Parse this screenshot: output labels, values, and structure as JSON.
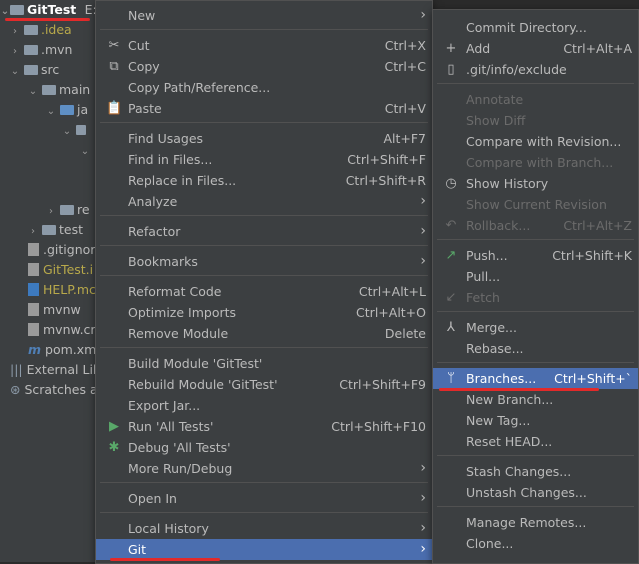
{
  "tree": {
    "title": "GitTest",
    "title_path": "E:\\",
    "rows": [
      {
        "label": ".idea",
        "kind": "folder"
      },
      {
        "label": ".mvn",
        "kind": "folder"
      },
      {
        "label": "src",
        "kind": "folder"
      },
      {
        "label": "main",
        "kind": "folder"
      },
      {
        "label": "ja",
        "kind": "folder-blue"
      },
      {
        "label": "re",
        "kind": "folder"
      },
      {
        "label": "test",
        "kind": "folder"
      },
      {
        "label": ".gitignor",
        "kind": "file"
      },
      {
        "label": "GitTest.i",
        "kind": "file"
      },
      {
        "label": "HELP.mc",
        "kind": "file"
      },
      {
        "label": "mvnw",
        "kind": "file"
      },
      {
        "label": "mvnw.cr",
        "kind": "file"
      },
      {
        "label": "pom.xm",
        "kind": "file"
      },
      {
        "label": "External Lib",
        "kind": "lib"
      },
      {
        "label": "Scratches a",
        "kind": "scratch"
      }
    ]
  },
  "menu1": {
    "new": "New",
    "cut": "Cut",
    "cut_sc": "Ctrl+X",
    "copy": "Copy",
    "copy_sc": "Ctrl+C",
    "copy_path": "Copy Path/Reference...",
    "paste": "Paste",
    "paste_sc": "Ctrl+V",
    "find_usages": "Find Usages",
    "find_usages_sc": "Alt+F7",
    "find_in_files": "Find in Files...",
    "find_in_files_sc": "Ctrl+Shift+F",
    "replace_in_files": "Replace in Files...",
    "replace_in_files_sc": "Ctrl+Shift+R",
    "analyze": "Analyze",
    "refactor": "Refactor",
    "bookmarks": "Bookmarks",
    "reformat": "Reformat Code",
    "reformat_sc": "Ctrl+Alt+L",
    "optimize": "Optimize Imports",
    "optimize_sc": "Ctrl+Alt+O",
    "remove_module": "Remove Module",
    "remove_module_sc": "Delete",
    "build_module": "Build Module 'GitTest'",
    "rebuild_module": "Rebuild Module 'GitTest'",
    "rebuild_module_sc": "Ctrl+Shift+F9",
    "export_jar": "Export Jar...",
    "run_tests": "Run 'All Tests'",
    "run_tests_sc": "Ctrl+Shift+F10",
    "debug_tests": "Debug 'All Tests'",
    "more_run": "More Run/Debug",
    "open_in": "Open In",
    "local_history": "Local History",
    "git": "Git"
  },
  "menu2": {
    "commit_dir": "Commit Directory...",
    "add": "Add",
    "add_sc": "Ctrl+Alt+A",
    "exclude": ".git/info/exclude",
    "annotate": "Annotate",
    "show_diff": "Show Diff",
    "compare_revision": "Compare with Revision...",
    "compare_branch": "Compare with Branch...",
    "show_history": "Show History",
    "show_current": "Show Current Revision",
    "rollback": "Rollback...",
    "rollback_sc": "Ctrl+Alt+Z",
    "push": "Push...",
    "push_sc": "Ctrl+Shift+K",
    "pull": "Pull...",
    "fetch": "Fetch",
    "merge": "Merge...",
    "rebase": "Rebase...",
    "branches": "Branches...",
    "branches_sc": "Ctrl+Shift+`",
    "new_branch": "New Branch...",
    "new_tag": "New Tag...",
    "reset_head": "Reset HEAD...",
    "stash": "Stash Changes...",
    "unstash": "Unstash Changes...",
    "manage_remotes": "Manage Remotes...",
    "clone": "Clone..."
  },
  "icons": {
    "chevron_right": "›",
    "chevron_down": "⌄",
    "submenu_arrow": "›",
    "cut": "✂",
    "plus": "+",
    "clock": "◷",
    "rollback": "↶",
    "push": "↗",
    "merge": "⅄",
    "branch": "ᛘ",
    "run": "▶",
    "debug": "✱"
  },
  "colors": {
    "selection": "#4b6eaf",
    "underline": "#e22a2a",
    "menu_bg": "#3c3f41"
  }
}
